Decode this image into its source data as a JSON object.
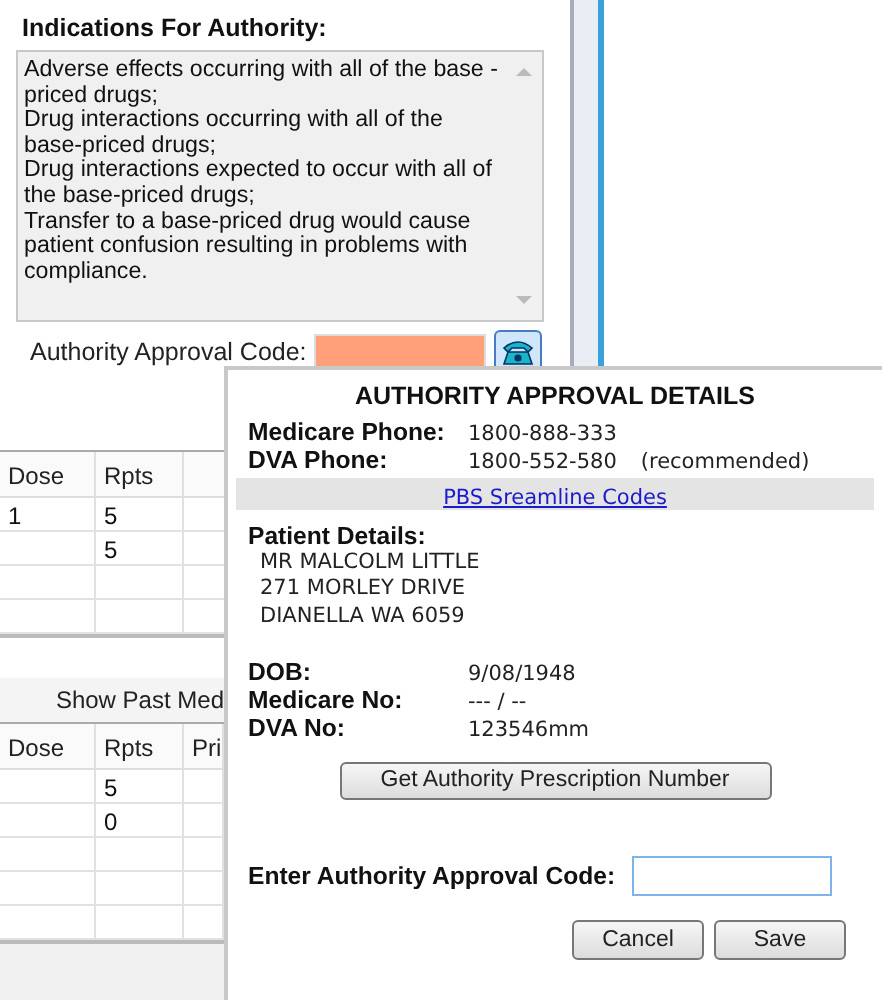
{
  "indications": {
    "title": "Indications For Authority:",
    "paragraphs": [
      "Adverse effects occurring with all of the base -priced drugs;",
      "Drug interactions occurring with all of the base-priced drugs;",
      "Drug interactions expected to occur with all of the base-priced drugs;",
      "Transfer to a base-priced drug would cause patient confusion resulting in problems with compliance."
    ]
  },
  "approval_code": {
    "label": "Authority Approval Code:"
  },
  "prescriptions_table": {
    "columns": [
      "Dose",
      "Rpts"
    ],
    "rows": [
      {
        "dose": "1",
        "rpts": "5"
      },
      {
        "rpts": "5"
      },
      {},
      {}
    ]
  },
  "past_button": "Show Past Med",
  "past_table": {
    "columns": [
      "Dose",
      "Rpts",
      "Pri"
    ],
    "rows": [
      {
        "rpts": "5"
      },
      {
        "rpts": "0"
      },
      {},
      {},
      {}
    ]
  },
  "dialog": {
    "title": "AUTHORITY APPROVAL DETAILS",
    "phones": [
      {
        "label": "Medicare Phone:",
        "value": "1800-888-333"
      },
      {
        "label": "DVA Phone:",
        "value": "1800-552-580",
        "note": "(recommended)"
      }
    ],
    "link": "PBS Sreamline Codes",
    "patient_label": "Patient Details:",
    "patient_lines": [
      "MR MALCOLM LITTLE",
      "271 MORLEY DRIVE",
      "DIANELLA WA  6059"
    ],
    "details": [
      {
        "label": "DOB:",
        "value": "9/08/1948"
      },
      {
        "label": "Medicare No:",
        "value": "--- / --"
      },
      {
        "label": "DVA No:",
        "value": "123546mm"
      }
    ],
    "get_button": "Get Authority Prescription Number",
    "approval_label": "Enter Authority Approval Code:",
    "approval_focused": true,
    "buttons": [
      "Cancel",
      "Save"
    ]
  }
}
